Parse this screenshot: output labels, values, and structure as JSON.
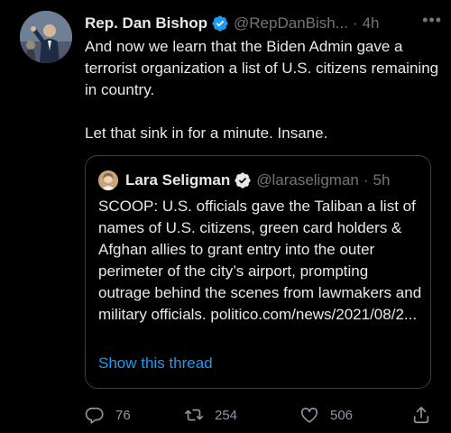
{
  "tweet": {
    "author_name": "Rep. Dan Bishop",
    "author_handle": "@RepDanBish...",
    "separator": "·",
    "time": "4h",
    "more_label": "•••",
    "text": "And now we learn that the Biden Admin gave a terrorist organization a list of U.S. citizens remaining in country.\n\nLet that sink in for a minute. Insane."
  },
  "quoted": {
    "author_name": "Lara Seligman",
    "author_handle": "@laraseligman",
    "separator": "·",
    "time": "5h",
    "text": "SCOOP: U.S. officials gave the Taliban a list of names of U.S. citizens, green card holders & Afghan allies to grant entry into the outer perimeter of the city’s airport, prompting outrage behind the scenes from lawmakers and military officials. politico.com/news/2021/08/2...",
    "show_thread": "Show this thread"
  },
  "actions": {
    "replies": "76",
    "retweets": "254",
    "likes": "506"
  },
  "colors": {
    "background": "#000000",
    "text": "#e7e9ea",
    "secondary": "#71767b",
    "link": "#1d9bf0",
    "verified": "#1d9bf0"
  }
}
